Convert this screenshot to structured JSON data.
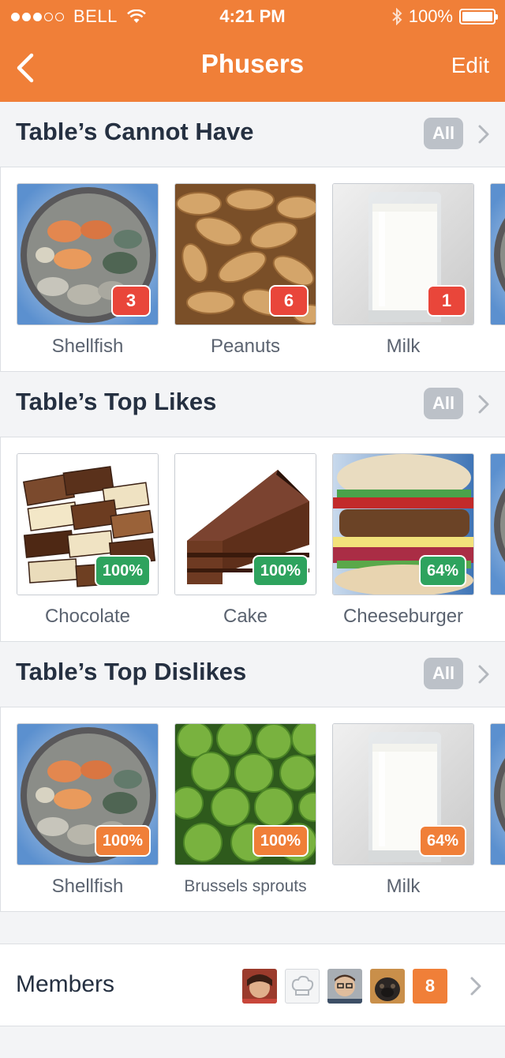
{
  "status_bar": {
    "carrier": "BELL",
    "time": "4:21 PM",
    "battery": "100%"
  },
  "nav": {
    "title": "Phusers",
    "edit": "Edit"
  },
  "sections": [
    {
      "title": "Table’s Cannot Have",
      "all_label": "All",
      "items": [
        {
          "label": "Shellfish",
          "badge": "3",
          "icon": "shellfish-image"
        },
        {
          "label": "Peanuts",
          "badge": "6",
          "icon": "peanuts-image"
        },
        {
          "label": "Milk",
          "badge": "1",
          "icon": "milk-image"
        }
      ]
    },
    {
      "title": "Table’s Top Likes",
      "all_label": "All",
      "items": [
        {
          "label": "Chocolate",
          "badge": "100%",
          "icon": "chocolate-image"
        },
        {
          "label": "Cake",
          "badge": "100%",
          "icon": "cake-image"
        },
        {
          "label": "Cheeseburger",
          "badge": "64%",
          "icon": "cheeseburger-image"
        }
      ]
    },
    {
      "title": "Table’s Top Dislikes",
      "all_label": "All",
      "items": [
        {
          "label": "Shellfish",
          "badge": "100%",
          "icon": "shellfish-image"
        },
        {
          "label": "Brussels sprouts",
          "badge": "100%",
          "icon": "brussels-sprouts-image"
        },
        {
          "label": "Milk",
          "badge": "64%",
          "icon": "milk-image"
        }
      ]
    }
  ],
  "members": {
    "label": "Members",
    "count": "8"
  },
  "colors": {
    "brand": "#f07f38",
    "cannot_have_badge": "#e9463a",
    "likes_badge": "#2ea35e",
    "dislikes_badge": "#f07f38"
  }
}
